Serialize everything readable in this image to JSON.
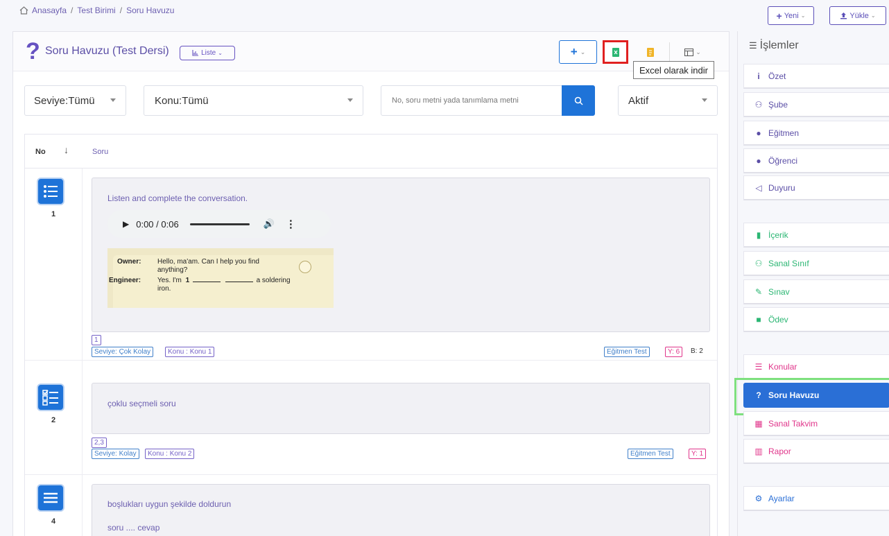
{
  "breadcrumb": {
    "home": "Anasayfa",
    "sep1": "/",
    "unit": "Test Birimi",
    "sep2": "/",
    "page": "Soru Havuzu"
  },
  "top_actions": {
    "new_label": "Yeni",
    "upload_label": "Yükle"
  },
  "header": {
    "title": "Soru Havuzu (Test Dersi)",
    "view_label": "Liste"
  },
  "tooltip": "Excel olarak indir",
  "filters": {
    "level": "Seviye:Tümü",
    "topic": "Konu:Tümü",
    "search_placeholder": "No, soru metni yada tanımlama metni",
    "status": "Aktif"
  },
  "table": {
    "col_no": "No",
    "col_question": "Soru"
  },
  "questions": [
    {
      "number": "1",
      "text": "Listen and complete the conversation.",
      "audio_time": "0:00 / 0:06",
      "image": {
        "owner_label": "Owner:",
        "owner_text": "Hello, ma'am. Can I help you find",
        "owner_text2": "anything?",
        "engineer_label": "Engineer:",
        "engineer_text": "Yes. I'm",
        "blank": "1",
        "engineer_text2": "a soldering",
        "engineer_text3": "iron."
      },
      "answer": "1",
      "level": "Seviye: Çok Kolay",
      "topic": "Konu : Konu 1",
      "teacher": "Eğitmen Test",
      "y": "Y: 6",
      "b": "B: 2"
    },
    {
      "number": "2",
      "text": "çoklu seçmeli soru",
      "answer": "2,3",
      "level": "Seviye: Kolay",
      "topic": "Konu : Konu 2",
      "teacher": "Eğitmen Test",
      "y": "Y: 1"
    },
    {
      "number": "4",
      "text": "boşlukları uygun şekilde doldurun",
      "text2": "soru .... cevap"
    }
  ],
  "sidebar": {
    "title": "İşlemler",
    "items": [
      {
        "label": "Özet",
        "icon": "info-icon"
      },
      {
        "label": "Şube",
        "icon": "users-icon"
      },
      {
        "label": "Eğitmen",
        "icon": "teacher-icon"
      },
      {
        "label": "Öğrenci",
        "icon": "user-icon"
      },
      {
        "label": "Duyuru",
        "icon": "megaphone-icon"
      },
      {
        "label": "İçerik",
        "icon": "files-icon"
      },
      {
        "label": "Sanal Sınıf",
        "icon": "users-icon"
      },
      {
        "label": "Sınav",
        "icon": "edit-icon"
      },
      {
        "label": "Ödev",
        "icon": "briefcase-icon"
      },
      {
        "label": "Konular",
        "icon": "list-icon"
      },
      {
        "label": "Soru Havuzu",
        "icon": "question-icon"
      },
      {
        "label": "Sanal Takvim",
        "icon": "calendar-icon"
      },
      {
        "label": "Rapor",
        "icon": "chart-icon"
      },
      {
        "label": "Ayarlar",
        "icon": "gear-icon"
      }
    ]
  },
  "colors": {
    "primary": "#6652c1",
    "accent_blue": "#1e73d8",
    "active": "#2a6fd6",
    "green": "#2bb673",
    "pink": "#e0348a",
    "highlight_red": "#e02020",
    "highlight_green": "#7ee07e"
  }
}
